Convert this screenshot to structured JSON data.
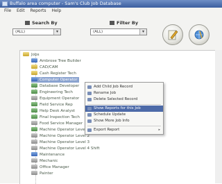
{
  "window": {
    "title": "Buffalo area computer - Sam's Club Job Database"
  },
  "menubar": [
    "File",
    "Edit",
    "Reports",
    "Help"
  ],
  "toolbar": {
    "label_left": "Search By",
    "label_right": "Filter By",
    "combo_left_value": "(ALL)",
    "combo_right_value": "(ALL)"
  },
  "tree": {
    "root": "Jobs",
    "rows": [
      {
        "label": "Ambrose Tree Builder",
        "icon": "blue"
      },
      {
        "label": "CAD/CAM",
        "icon": "yellow"
      },
      {
        "label": "Cash Register Tech",
        "icon": "yellow"
      },
      {
        "label": "Computer Operator",
        "icon": "blue"
      },
      {
        "label": "Database Developer",
        "icon": "green"
      },
      {
        "label": "Engineering Tech",
        "icon": "green"
      },
      {
        "label": "Equipment Operator",
        "icon": "gray"
      },
      {
        "label": "Field Service Rep",
        "icon": "green"
      },
      {
        "label": "Help Desk Analyst",
        "icon": "green"
      },
      {
        "label": "Final Inspection Tech",
        "icon": "green"
      },
      {
        "label": "Food Service Manager",
        "icon": "gray"
      },
      {
        "label": "Machine Operator Level 1",
        "icon": "green"
      },
      {
        "label": "Machine Operator Level 2",
        "icon": "gray"
      },
      {
        "label": "Machine Operator Level 3",
        "icon": "gray"
      },
      {
        "label": "Machine Operator Level 4 Shift",
        "icon": "gray"
      },
      {
        "label": "Maintenance",
        "icon": "blue"
      },
      {
        "label": "Mechanic",
        "icon": "gray"
      },
      {
        "label": "Office Manager",
        "icon": "gray"
      },
      {
        "label": "Painter",
        "icon": "gray"
      }
    ],
    "selected_index": 3
  },
  "context_menu": {
    "items": [
      {
        "label": "Add Child Job Record",
        "highlight": false
      },
      {
        "label": "Rename Job",
        "highlight": false
      },
      {
        "label": "Delete Selected Record",
        "highlight": false
      },
      {
        "label": "Show Reports for this Job",
        "highlight": true
      },
      {
        "label": "Schedule Update",
        "highlight": false
      },
      {
        "label": "Show More Job Info",
        "highlight": false
      },
      {
        "label": "Export Report",
        "highlight": false
      }
    ]
  }
}
